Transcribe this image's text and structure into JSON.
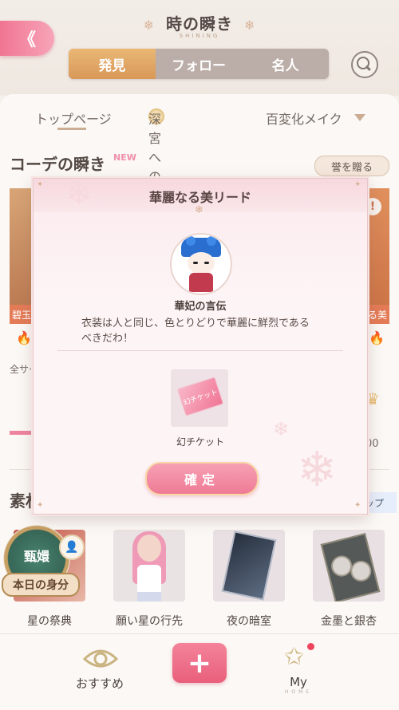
{
  "header": {
    "back_label": "《",
    "title": "時の瞬き",
    "subtitle": "SHINING",
    "segments": [
      "発見",
      "フォロー",
      "名人"
    ],
    "active_segment": 0
  },
  "subtabs": {
    "items": [
      "トップページ",
      "深宮への夢",
      "百変化メイク"
    ],
    "active": 0
  },
  "section_coord": {
    "title": "コーデの瞬き",
    "badge": "NEW",
    "gift_button": "誉を贈る",
    "left_card_label": "碧玉",
    "right_card_label": "る美",
    "side_text": "全サー",
    "zero_value": "00"
  },
  "section_material": {
    "title": "素材",
    "right_chip": "ップ",
    "badge_name": "甄嬛",
    "badge_ribbon": "本日の身分",
    "items": [
      {
        "name": "星の祭典"
      },
      {
        "name": "願い星の行先"
      },
      {
        "name": "夜の暗室"
      },
      {
        "name": "金墨と銀杏"
      }
    ]
  },
  "bottom_nav": {
    "recommend_label": "おすすめ",
    "add_label": "+",
    "my_label": "My",
    "my_sub": "HOME"
  },
  "dialog": {
    "title": "華麗なる美リード",
    "speaker": "華妃の言伝",
    "message": "衣装は人と同じ、色とりどりで華麗に鮮烈であるべきだわ！",
    "item_card_text": "幻チケット",
    "item_label": "幻チケット",
    "confirm_label": "確定"
  },
  "colors": {
    "accent_orange": "#d79350",
    "accent_pink": "#ef7b96",
    "new_badge": "#f08aa5"
  }
}
